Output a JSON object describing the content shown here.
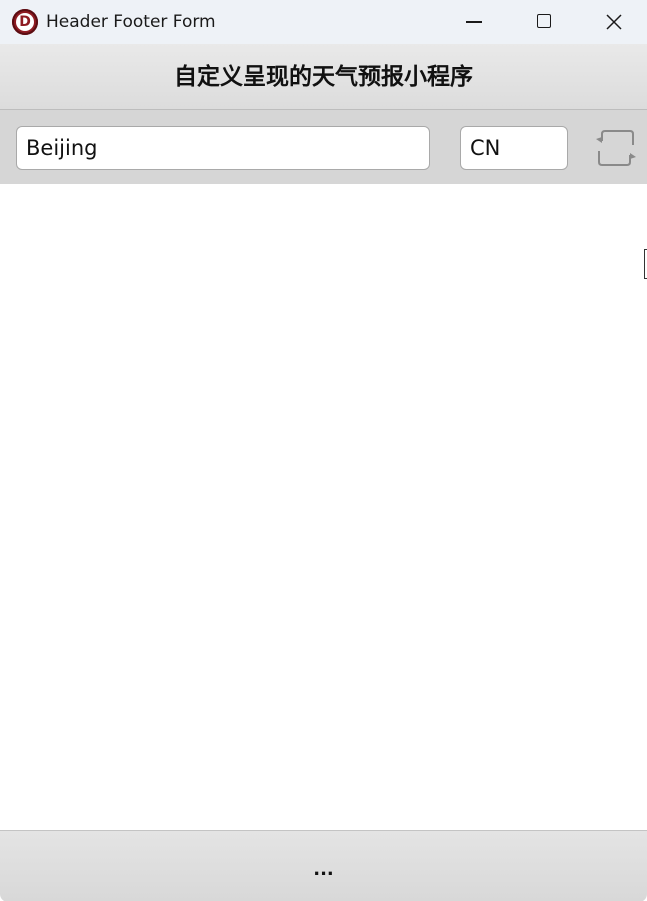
{
  "window": {
    "title": "Header Footer Form",
    "icon_letter": "D"
  },
  "header": {
    "title": "自定义呈现的天气预报小程序"
  },
  "toolbar": {
    "city_value": "Beijing",
    "country_value": "CN",
    "refresh_icon": "refresh-icon"
  },
  "footer": {
    "status_text": "..."
  },
  "colors": {
    "titlebar_bg": "#eef2f7",
    "header_bg": "#e2e2e2",
    "toolbar_bg": "#d6d6d6",
    "footer_bg": "#dedede",
    "icon_red": "#8e1b22"
  }
}
